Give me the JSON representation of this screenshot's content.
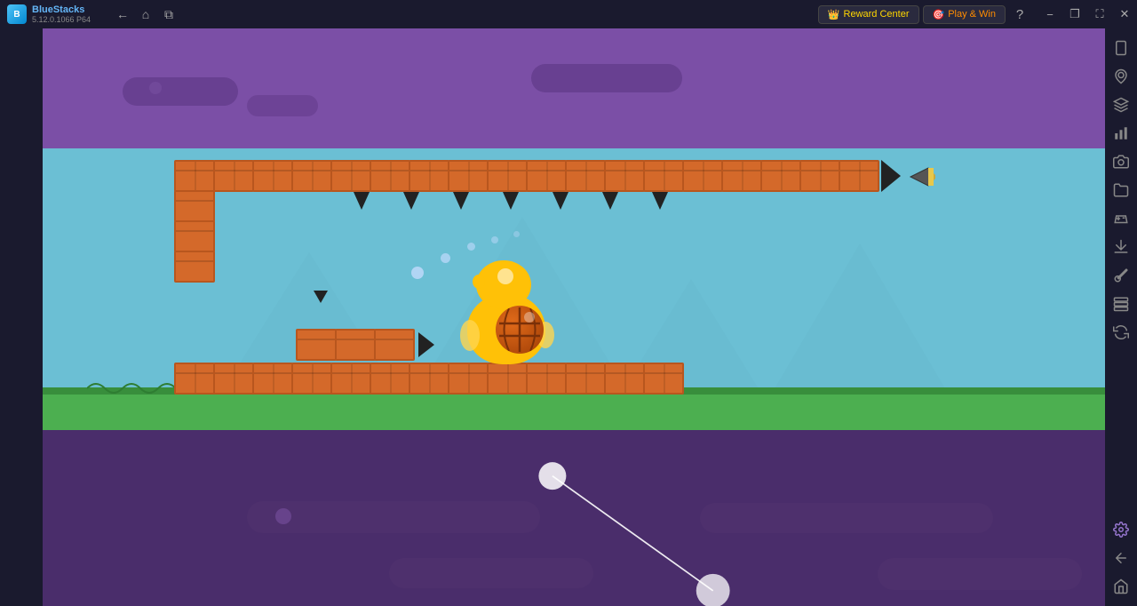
{
  "titlebar": {
    "app_name": "BlueStacks",
    "app_version": "5.12.0.1066  P64",
    "back_label": "←",
    "home_label": "⌂",
    "multi_label": "⧉",
    "reward_label": "Reward Center",
    "play_win_label": "Play & Win",
    "help_label": "?",
    "minimize_label": "−",
    "restore_label": "❐",
    "close_label": "✕",
    "maximize_label": "⛶"
  },
  "sidebar": {
    "icons": [
      {
        "name": "sidebar-phone-icon",
        "glyph": "📱"
      },
      {
        "name": "sidebar-search-icon",
        "glyph": "🔍"
      },
      {
        "name": "sidebar-group-icon",
        "glyph": "👥"
      },
      {
        "name": "sidebar-chart-icon",
        "glyph": "📊"
      },
      {
        "name": "sidebar-camera-icon",
        "glyph": "📷"
      },
      {
        "name": "sidebar-folder-icon",
        "glyph": "📁"
      },
      {
        "name": "sidebar-game-icon",
        "glyph": "🎮"
      },
      {
        "name": "sidebar-download-icon",
        "glyph": "⬇"
      },
      {
        "name": "sidebar-brush-icon",
        "glyph": "🖌"
      },
      {
        "name": "sidebar-layers-icon",
        "glyph": "⬛"
      },
      {
        "name": "sidebar-refresh-icon",
        "glyph": "↺"
      },
      {
        "name": "sidebar-settings-icon",
        "glyph": "⚙"
      },
      {
        "name": "sidebar-back-icon",
        "glyph": "←"
      },
      {
        "name": "sidebar-home2-icon",
        "glyph": "⌂"
      }
    ]
  },
  "game": {
    "bricks_top_count": 18,
    "bricks_bottom_count": 14,
    "bricks_left_count": 3,
    "bricks_mid_count": 3
  },
  "colors": {
    "bg_purple": "#7b4fa6",
    "bg_light_blue": "#6bbfd4",
    "brick_orange": "#d4692a",
    "ground_green": "#4caf50",
    "lower_purple": "#4a2d6b",
    "character_yellow": "#ffc107",
    "basketball_brown": "#c0550a"
  }
}
